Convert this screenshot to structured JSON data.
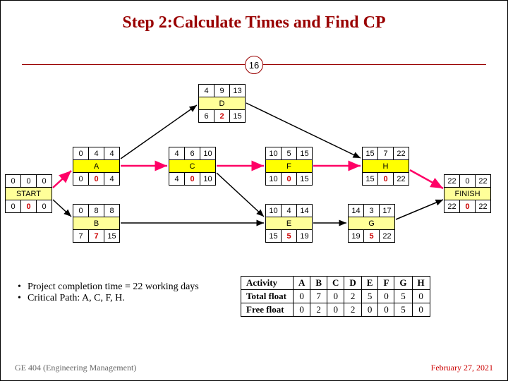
{
  "title": "Step 2:Calculate Times and Find CP",
  "page_number": "16",
  "nodes": {
    "START": {
      "label": "START",
      "es": "0",
      "d": "0",
      "ef": "0",
      "ls": "0",
      "tf": "0",
      "lf": "0"
    },
    "A": {
      "label": "A",
      "es": "0",
      "d": "4",
      "ef": "4",
      "ls": "0",
      "tf": "0",
      "lf": "4"
    },
    "B": {
      "label": "B",
      "es": "0",
      "d": "8",
      "ef": "8",
      "ls": "7",
      "tf": "7",
      "lf": "15"
    },
    "C": {
      "label": "C",
      "es": "4",
      "d": "6",
      "ef": "10",
      "ls": "4",
      "tf": "0",
      "lf": "10"
    },
    "D": {
      "label": "D",
      "es": "4",
      "d": "9",
      "ef": "13",
      "ls": "6",
      "tf": "2",
      "lf": "15"
    },
    "E": {
      "label": "E",
      "es": "10",
      "d": "4",
      "ef": "14",
      "ls": "15",
      "tf": "5",
      "lf": "19"
    },
    "F": {
      "label": "F",
      "es": "10",
      "d": "5",
      "ef": "15",
      "ls": "10",
      "tf": "0",
      "lf": "15"
    },
    "G": {
      "label": "G",
      "es": "14",
      "d": "3",
      "ef": "17",
      "ls": "19",
      "tf": "5",
      "lf": "22"
    },
    "H": {
      "label": "H",
      "es": "15",
      "d": "7",
      "ef": "22",
      "ls": "15",
      "tf": "0",
      "lf": "22"
    },
    "FINISH": {
      "label": "FINISH",
      "es": "22",
      "d": "0",
      "ef": "22",
      "ls": "22",
      "tf": "0",
      "lf": "22"
    }
  },
  "notes": {
    "completion": "Project completion time = 22 working days",
    "cp": "Critical Path: A, C, F, H."
  },
  "float_table": {
    "headers": [
      "Activity",
      "A",
      "B",
      "C",
      "D",
      "E",
      "F",
      "G",
      "H"
    ],
    "rows": [
      {
        "h": "Total float",
        "v": [
          "0",
          "7",
          "0",
          "2",
          "5",
          "0",
          "5",
          "0"
        ]
      },
      {
        "h": "Free float",
        "v": [
          "0",
          "2",
          "0",
          "2",
          "0",
          "0",
          "5",
          "0"
        ]
      }
    ]
  },
  "footer": {
    "course": "GE 404 (Engineering Management)",
    "date": "February 27, 2021"
  }
}
